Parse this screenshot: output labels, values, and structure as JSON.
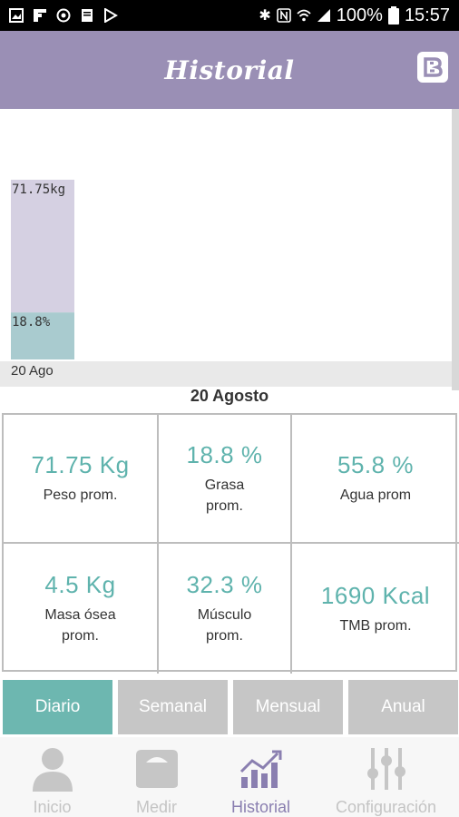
{
  "status_bar": {
    "battery": "100%",
    "time": "15:57"
  },
  "header": {
    "title": "Historial"
  },
  "chart_data": {
    "type": "bar",
    "categories": [
      "20 Ago"
    ],
    "series": [
      {
        "values": [
          18.8
        ],
        "label": "18.8%",
        "color": "#a9cbcf"
      },
      {
        "values": [
          71.75
        ],
        "label": "71.75kg",
        "color": "#d5d0e2"
      }
    ],
    "caption": "20 Agosto"
  },
  "stats": [
    {
      "value": "71.75 Kg",
      "label": "Peso prom."
    },
    {
      "value": "18.8 %",
      "label": "Grasa\nprom."
    },
    {
      "value": "55.8 %",
      "label": "Agua prom"
    },
    {
      "value": "4.5  Kg",
      "label": "Masa ósea\nprom."
    },
    {
      "value": "32.3 %",
      "label": "Músculo\nprom."
    },
    {
      "value": "1690 Kcal",
      "label": "TMB prom."
    }
  ],
  "periods": [
    "Diario",
    "Semanal",
    "Mensual",
    "Anual"
  ],
  "active_period": "Diario",
  "nav": [
    {
      "label": "Inicio",
      "icon": "person-icon"
    },
    {
      "label": "Medir",
      "icon": "scale-icon"
    },
    {
      "label": "Historial",
      "icon": "chart-icon"
    },
    {
      "label": "Configuración",
      "icon": "sliders-icon"
    }
  ],
  "active_nav": "Historial",
  "colors": {
    "header": "#9a8fb5",
    "accent": "#5fb3ad",
    "active_tab": "#6db7b0",
    "inactive_tab": "#c6c6c6",
    "nav_active": "#8a7fb0"
  }
}
